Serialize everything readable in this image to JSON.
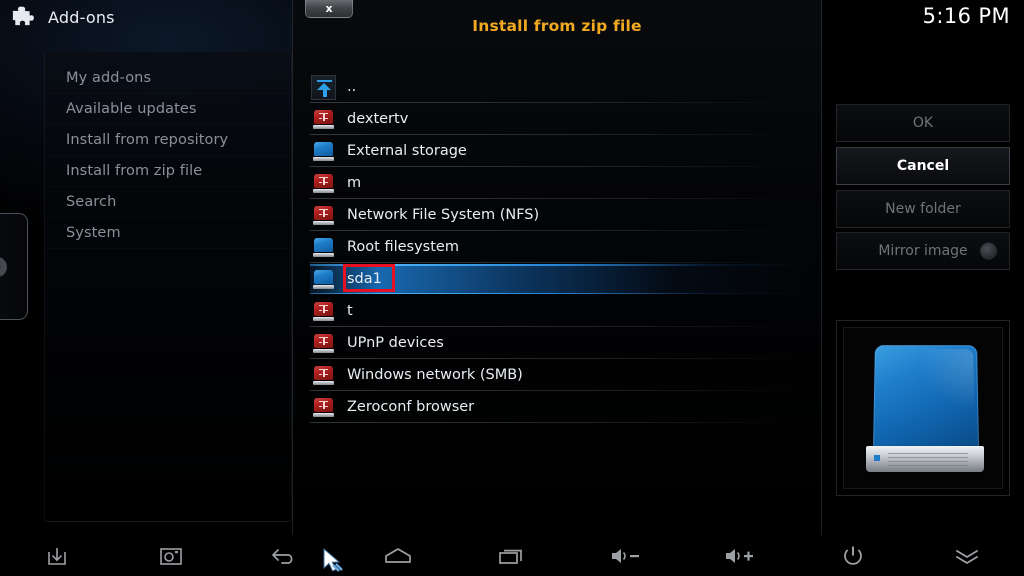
{
  "header": {
    "icon": "puzzle-icon",
    "title": "Add-ons",
    "clock": "5:16 PM"
  },
  "sidebar": {
    "items": [
      {
        "label": "My add-ons"
      },
      {
        "label": "Available updates"
      },
      {
        "label": "Install from repository"
      },
      {
        "label": "Install from zip file"
      },
      {
        "label": "Search"
      },
      {
        "label": "System"
      }
    ]
  },
  "dialog": {
    "title": "Install from zip file",
    "close_label": "x",
    "close_icon": "close-icon",
    "list": [
      {
        "label": "..",
        "icon": "up-folder-icon",
        "type": "up",
        "selected": false
      },
      {
        "label": "dextertv",
        "icon": "network-drive-icon",
        "type": "network",
        "selected": false
      },
      {
        "label": "External storage",
        "icon": "drive-icon",
        "type": "local",
        "selected": false
      },
      {
        "label": "m",
        "icon": "network-drive-icon",
        "type": "network",
        "selected": false
      },
      {
        "label": "Network File System (NFS)",
        "icon": "network-drive-icon",
        "type": "network",
        "selected": false
      },
      {
        "label": "Root filesystem",
        "icon": "drive-icon",
        "type": "local",
        "selected": false
      },
      {
        "label": "sda1",
        "icon": "drive-icon",
        "type": "local",
        "selected": true
      },
      {
        "label": "t",
        "icon": "network-drive-icon",
        "type": "network",
        "selected": false
      },
      {
        "label": "UPnP devices",
        "icon": "network-drive-icon",
        "type": "network",
        "selected": false
      },
      {
        "label": "Windows network (SMB)",
        "icon": "network-drive-icon",
        "type": "network",
        "selected": false
      },
      {
        "label": "Zeroconf browser",
        "icon": "network-drive-icon",
        "type": "network",
        "selected": false
      }
    ]
  },
  "buttons": {
    "ok": "OK",
    "cancel": "Cancel",
    "new_folder": "New folder",
    "mirror_image": "Mirror image",
    "focused": "Cancel"
  },
  "preview": {
    "icon": "hard-drive-image"
  },
  "navbar": {
    "items": [
      {
        "icon": "download-icon"
      },
      {
        "icon": "screenshot-icon"
      },
      {
        "icon": "back-icon"
      },
      {
        "icon": "home-icon"
      },
      {
        "icon": "recents-icon"
      },
      {
        "icon": "volume-down-icon"
      },
      {
        "icon": "volume-up-icon"
      },
      {
        "icon": "power-icon"
      },
      {
        "icon": "chevron-double-down-icon"
      }
    ]
  },
  "colors": {
    "accent_title": "#f0a921",
    "selection_blue": "#1a6eb9",
    "annotation_red": "#e81123",
    "local_drive": "#1e7ecb",
    "network_drive": "#ad1f1f"
  }
}
